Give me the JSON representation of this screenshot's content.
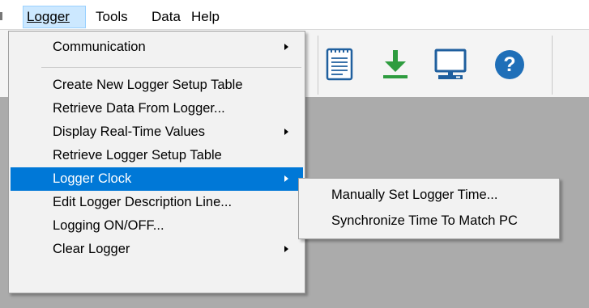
{
  "menubar": {
    "logger": "Logger",
    "tools": "Tools",
    "data": "Data",
    "help": "Help"
  },
  "toolbar": {
    "icons": [
      "notepad-icon",
      "download-icon",
      "computer-icon",
      "help-icon"
    ],
    "download_color": "#2e9c3f",
    "computer_color": "#1f5f9e",
    "help_color": "#1f6fb8"
  },
  "logger_menu": {
    "items": [
      {
        "label": "Communication",
        "submenu": true
      },
      {
        "label": "Create New Logger Setup Table",
        "submenu": false
      },
      {
        "label": "Retrieve Data From Logger...",
        "submenu": false
      },
      {
        "label": "Display Real-Time Values",
        "submenu": true
      },
      {
        "label": "Retrieve Logger Setup Table",
        "submenu": false
      },
      {
        "label": "Logger Clock",
        "submenu": true,
        "highlighted": true
      },
      {
        "label": "Edit Logger Description Line...",
        "submenu": false
      },
      {
        "label": "Logging ON/OFF...",
        "submenu": false
      },
      {
        "label": "Clear Logger",
        "submenu": true
      }
    ]
  },
  "clock_submenu": {
    "items": [
      {
        "label": "Manually Set Logger Time..."
      },
      {
        "label": "Synchronize Time To Match PC"
      }
    ]
  },
  "colors": {
    "highlight": "#0078d7",
    "workspace": "#ababab",
    "menu_bg": "#f2f2f2"
  }
}
